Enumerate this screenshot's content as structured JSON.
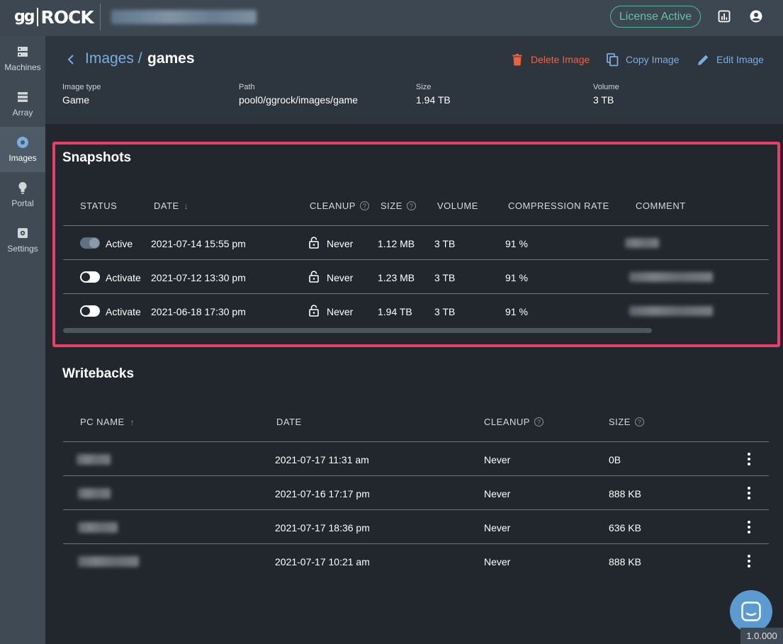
{
  "topbar": {
    "logo_left": "gg",
    "logo_right": "ROCK",
    "org_name": "Organisation name",
    "license": "License Active"
  },
  "sidebar": {
    "items": [
      {
        "label": "Machines",
        "icon": "server-icon"
      },
      {
        "label": "Array",
        "icon": "array-icon"
      },
      {
        "label": "Images",
        "icon": "disc-icon",
        "active": true
      },
      {
        "label": "Portal",
        "icon": "bulb-icon"
      },
      {
        "label": "Settings",
        "icon": "gear-icon"
      }
    ]
  },
  "header": {
    "breadcrumb_parent": "Images /",
    "breadcrumb_current": "games",
    "actions": {
      "delete": "Delete Image",
      "copy": "Copy Image",
      "edit": "Edit Image"
    },
    "meta": [
      {
        "label": "Image type",
        "value": "Game"
      },
      {
        "label": "Path",
        "value": "pool0/ggrock/images/game"
      },
      {
        "label": "Size",
        "value": "1.94 TB"
      },
      {
        "label": "Volume",
        "value": "3 TB"
      }
    ]
  },
  "snapshots": {
    "title": "Snapshots",
    "columns": {
      "status": "STATUS",
      "date": "DATE",
      "cleanup": "CLEANUP",
      "size": "SIZE",
      "volume": "VOLUME",
      "compression": "COMPRESSION RATE",
      "comment": "COMMENT"
    },
    "rows": [
      {
        "status": "Active",
        "on": true,
        "date": "2021-07-14 15:55 pm",
        "cleanup": "Never",
        "size": "1.12 MB",
        "volume": "3 TB",
        "compression": "91 %"
      },
      {
        "status": "Activate",
        "on": false,
        "date": "2021-07-12 13:30 pm",
        "cleanup": "Never",
        "size": "1.23 MB",
        "volume": "3 TB",
        "compression": "91 %"
      },
      {
        "status": "Activate",
        "on": false,
        "date": "2021-06-18 17:30 pm",
        "cleanup": "Never",
        "size": "1.94 TB",
        "volume": "3 TB",
        "compression": "91 %"
      }
    ]
  },
  "writebacks": {
    "title": "Writebacks",
    "columns": {
      "pc_name": "PC NAME",
      "date": "DATE",
      "cleanup": "CLEANUP",
      "size": "SIZE"
    },
    "rows": [
      {
        "date": "2021-07-17 11:31 am",
        "cleanup": "Never",
        "size": "0B"
      },
      {
        "date": "2021-07-16 17:17 pm",
        "cleanup": "Never",
        "size": "888 KB"
      },
      {
        "date": "2021-07-17 18:36 pm",
        "cleanup": "Never",
        "size": "636 KB"
      },
      {
        "date": "2021-07-17 10:21 am",
        "cleanup": "Never",
        "size": "888 KB"
      }
    ]
  },
  "version": "1.0.000",
  "colors": {
    "accent_blue": "#7aaede",
    "danger": "#f0623e",
    "license_green": "#5ec5a3",
    "highlight": "#ea3f6a"
  }
}
